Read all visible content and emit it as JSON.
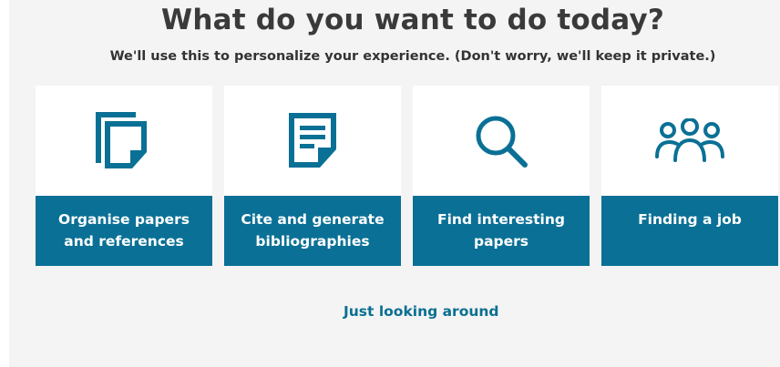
{
  "header": {
    "title": "What do you want to do today?",
    "subtitle": "We'll use this to personalize your experience. (Don't worry, we'll keep it private.)"
  },
  "options": [
    {
      "label": "Organise papers\nand references",
      "icon": "documents-stack-icon"
    },
    {
      "label": "Cite and generate\nbibliographies",
      "icon": "document-lines-icon"
    },
    {
      "label": "Find interesting\npapers",
      "icon": "search-icon"
    },
    {
      "label": "Finding a job",
      "icon": "people-group-icon"
    }
  ],
  "footer": {
    "link_label": "Just looking around"
  },
  "colors": {
    "accent": "#0a7095",
    "background": "#f4f4f4",
    "card": "#ffffff",
    "title": "#3a3a3a"
  }
}
